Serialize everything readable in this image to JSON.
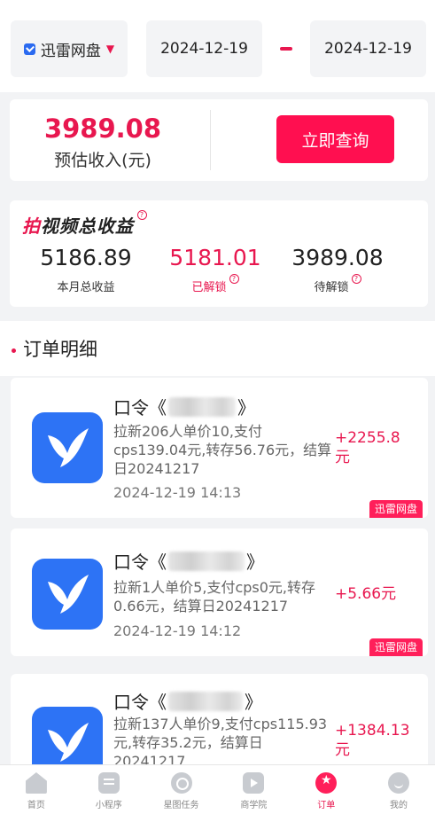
{
  "filter": {
    "platform": "迅雷网盘",
    "start_date": "2024-12-19",
    "end_date": "2024-12-19"
  },
  "estimate": {
    "value": "3989.08",
    "label": "预估收入(元)",
    "query_button": "立即查询"
  },
  "revenue": {
    "title_first": "拍",
    "title_rest": "视频总收益",
    "stats": [
      {
        "value": "5186.89",
        "label": "本月总收益"
      },
      {
        "value": "5181.01",
        "label": "已解锁"
      },
      {
        "value": "3989.08",
        "label": "待解锁"
      }
    ]
  },
  "orders_section": {
    "title": "订单明细"
  },
  "orders": [
    {
      "title_prefix": "口令《",
      "title_suffix": "》",
      "desc": "拉新206人单价10,支付cps139.04元,转存56.76元，结算日20241217",
      "time": "2024-12-19 14:13",
      "amount": "+2255.8元",
      "tag": "迅雷网盘"
    },
    {
      "title_prefix": "口令《",
      "title_suffix": "》",
      "desc": "拉新1人单价5,支付cps0元,转存0.66元，结算日20241217",
      "time": "2024-12-19 14:12",
      "amount": "+5.66元",
      "tag": "迅雷网盘"
    },
    {
      "title_prefix": "口令《",
      "title_suffix": "》",
      "desc": "拉新137人单价9,支付cps115.93元,转存35.2元，结算日20241217",
      "time": "",
      "amount": "+1384.13元",
      "tag": ""
    }
  ],
  "tabbar": {
    "items": [
      {
        "label": "首页",
        "icon": "home-icon"
      },
      {
        "label": "小程序",
        "icon": "mini-program-icon"
      },
      {
        "label": "星图任务",
        "icon": "star-map-icon"
      },
      {
        "label": "商学院",
        "icon": "play-icon"
      },
      {
        "label": "订单",
        "icon": "order-icon"
      },
      {
        "label": "我的",
        "icon": "profile-icon"
      }
    ],
    "active": "订单"
  },
  "colors": {
    "accent": "#e8174f",
    "button": "#ff0f50",
    "app_icon": "#2d73f5"
  }
}
